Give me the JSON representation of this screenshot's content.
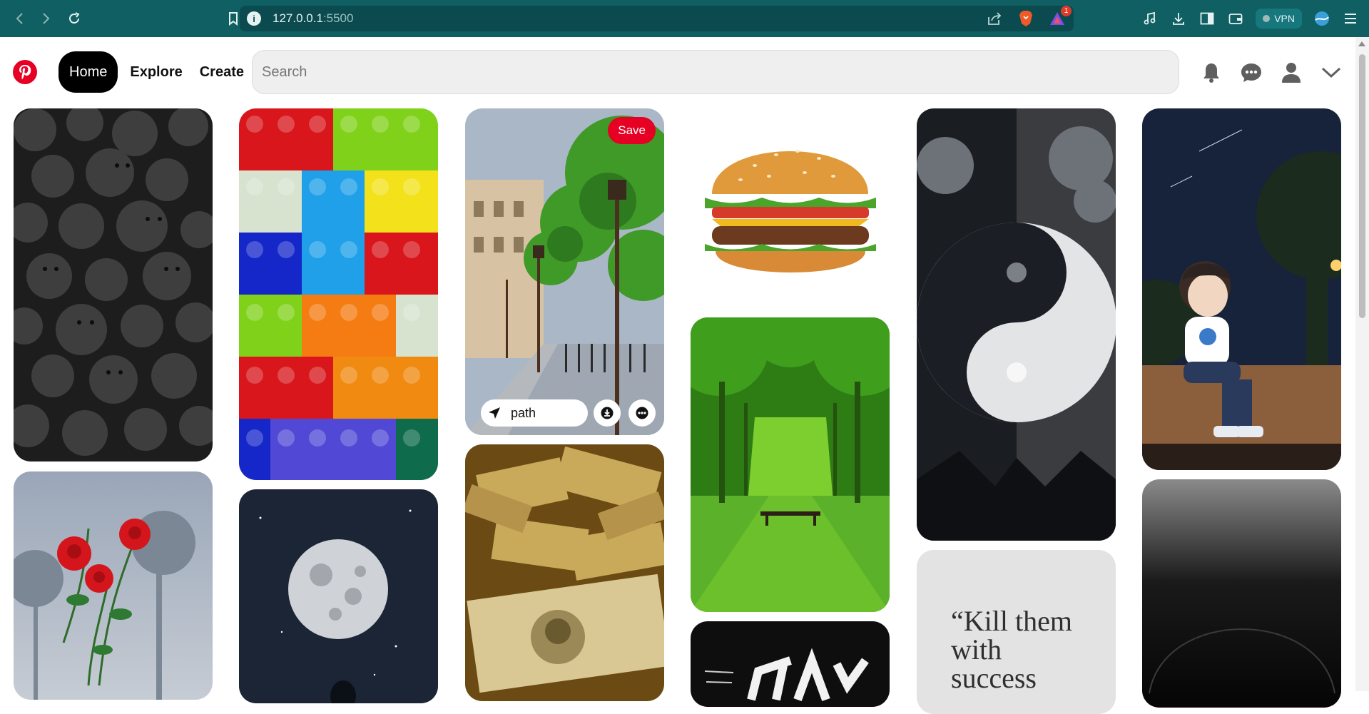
{
  "browser": {
    "url_host": "127.0.0.1",
    "url_port": ":5500",
    "rewards_badge": "1",
    "vpn_label": "VPN"
  },
  "header": {
    "nav": {
      "home": "Home",
      "explore": "Explore",
      "create": "Create"
    },
    "search_placeholder": "Search"
  },
  "pins": {
    "hover_pin": {
      "save_label": "Save",
      "board_name": "path"
    },
    "quote_text": "“Kill them with success"
  },
  "colors": {
    "browser_bar": "#0f5f63",
    "brand_red": "#e60023",
    "active_nav": "#000000"
  }
}
